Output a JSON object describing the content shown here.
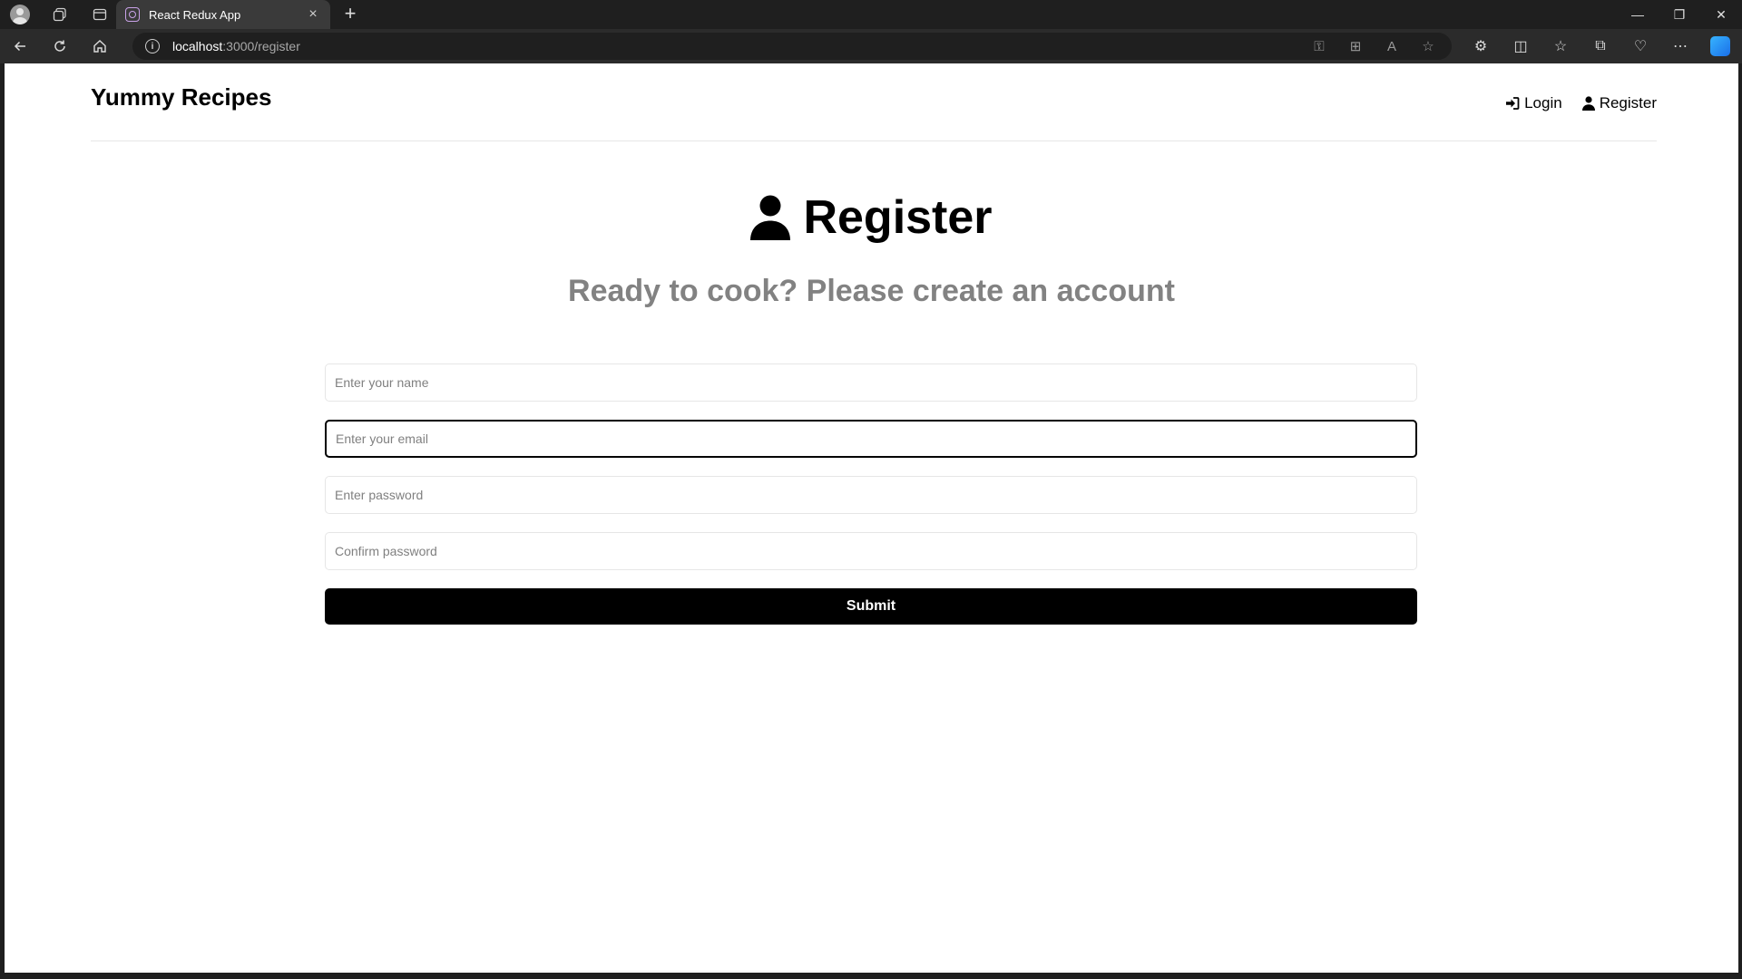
{
  "browser": {
    "tab_title": "React Redux App",
    "tab_close": "×",
    "new_tab": "+",
    "url_host": "localhost",
    "url_path": ":3000/register",
    "window_controls": {
      "minimize": "—",
      "restore": "❐",
      "close": "✕"
    }
  },
  "header": {
    "logo": "Yummy Recipes",
    "nav": [
      {
        "label": "Login",
        "icon": "sign-in-icon"
      },
      {
        "label": "Register",
        "icon": "user-icon"
      }
    ]
  },
  "main": {
    "heading": "Register",
    "heading_icon": "user-icon",
    "subheading": "Ready to cook? Please create an account"
  },
  "form": {
    "name_placeholder": "Enter your name",
    "email_placeholder": "Enter your email",
    "password_placeholder": "Enter password",
    "confirm_placeholder": "Confirm password",
    "submit_label": "Submit"
  },
  "colors": {
    "accent": "#000000",
    "subheading": "#828282",
    "browser_chrome": "#1f1f1f"
  }
}
